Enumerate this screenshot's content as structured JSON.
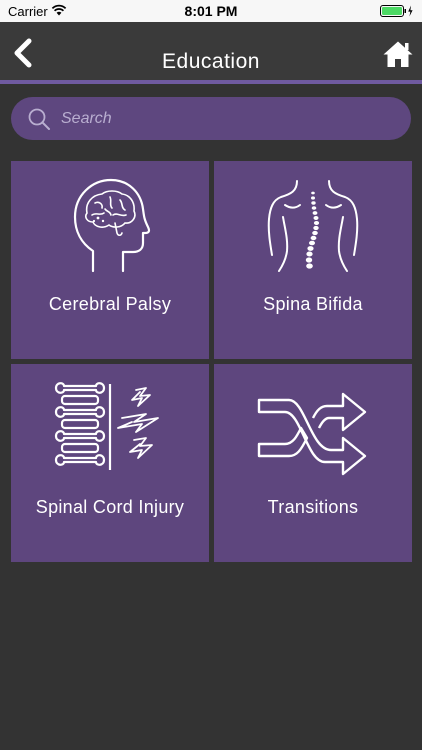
{
  "status_bar": {
    "carrier": "Carrier",
    "time": "8:01 PM",
    "icons": [
      "wifi-icon",
      "battery-icon",
      "charging-bolt-icon"
    ]
  },
  "header": {
    "title": "Education",
    "back_icon": "chevron-left-icon",
    "home_icon": "home-icon",
    "accent_color": "#6f5aa0"
  },
  "search": {
    "placeholder": "Search",
    "value": "",
    "icon": "search-icon"
  },
  "tiles": [
    {
      "label": "Cerebral Palsy",
      "icon": "brain-head-icon"
    },
    {
      "label": "Spina Bifida",
      "icon": "spine-back-icon"
    },
    {
      "label": "Spinal Cord Injury",
      "icon": "vertebrae-lightning-icon"
    },
    {
      "label": "Transitions",
      "icon": "shuffle-arrows-icon"
    }
  ],
  "colors": {
    "background": "#333333",
    "tile": "#5e467e",
    "search_bg": "#5e477f",
    "text": "#ffffff"
  }
}
